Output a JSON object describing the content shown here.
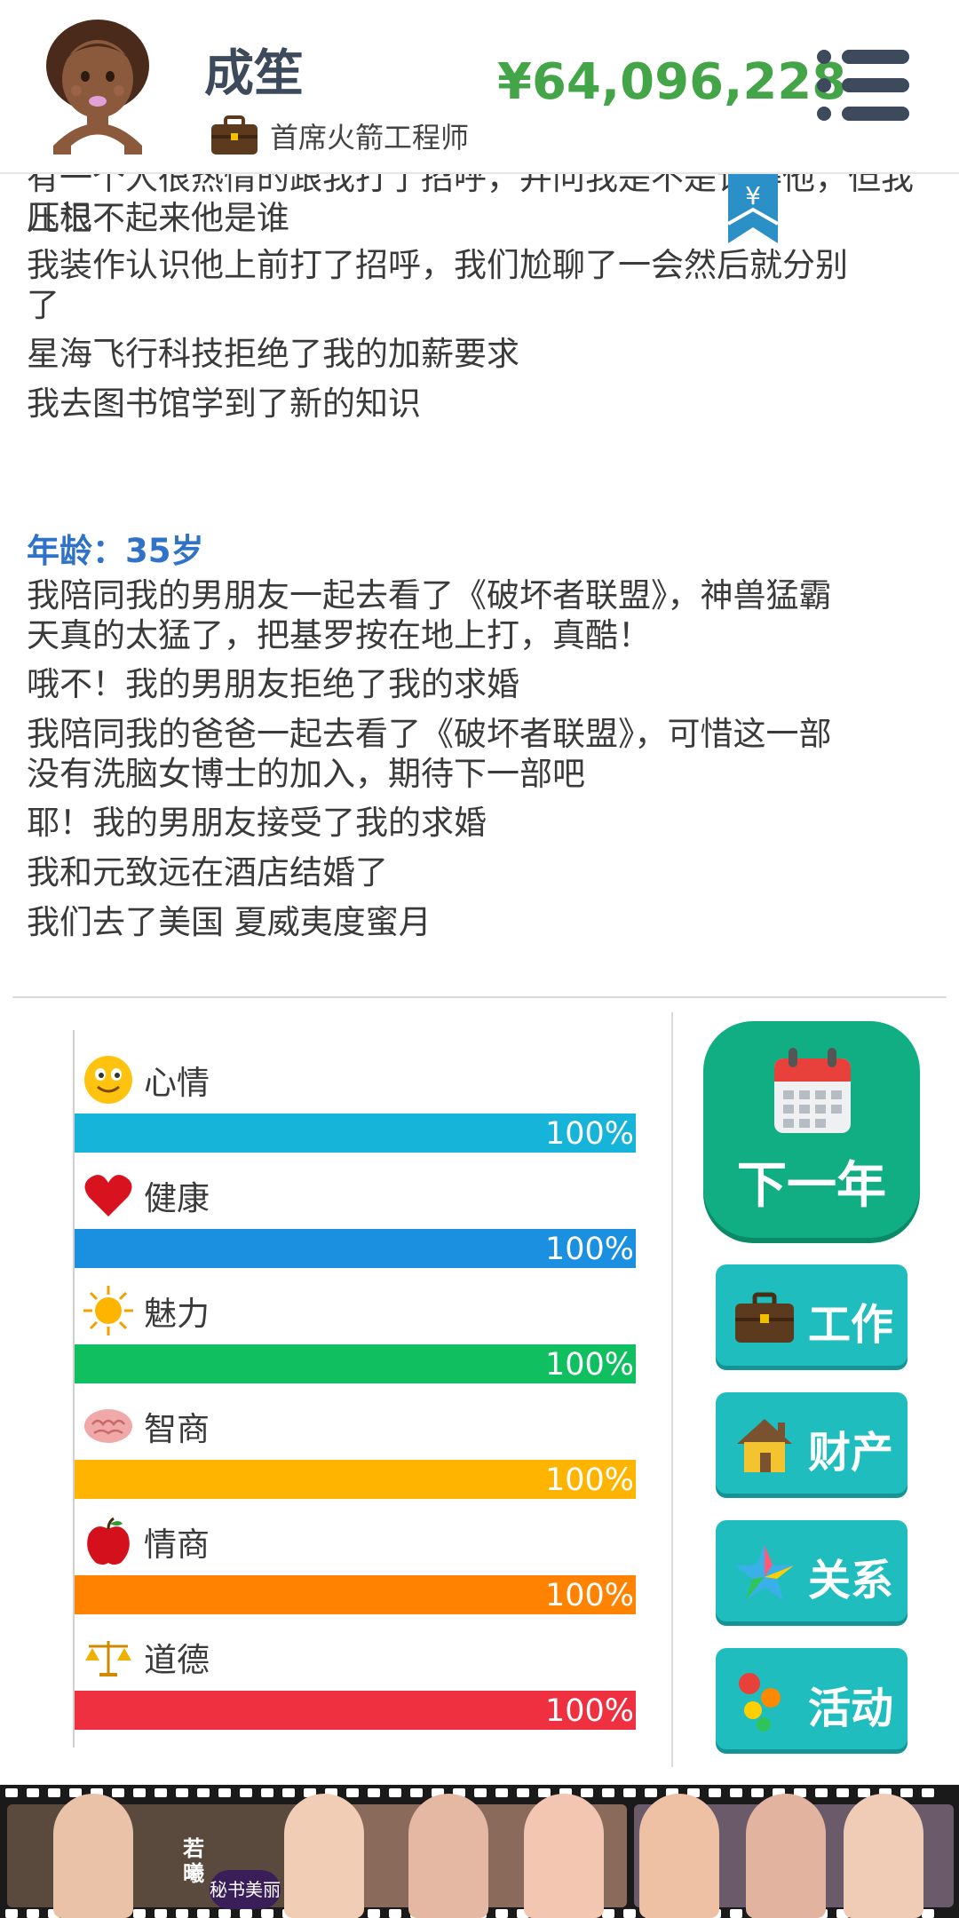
{
  "header": {
    "name": "成笙",
    "job_title": "首席火箭工程师",
    "money": "¥64,096,228"
  },
  "log": {
    "lines_top": [
      "有一个人很热情的跟我打了招呼，并问我是不是记得他，但我压根",
      "儿记不起来他是谁",
      "我装作认识他上前打了招呼，我们尬聊了一会然后就分别",
      "了",
      "星海飞行科技拒绝了我的加薪要求",
      "我去图书馆学到了新的知识"
    ],
    "age_label": "年龄：35岁",
    "lines_bottom": [
      "我陪同我的男朋友一起去看了《破坏者联盟》，神兽猛霸",
      "天真的太猛了，把基罗按在地上打，真酷！",
      "哦不！我的男朋友拒绝了我的求婚",
      "我陪同我的爸爸一起去看了《破坏者联盟》，可惜这一部",
      "没有洗脑女博士的加入，期待下一部吧",
      "耶！我的男朋友接受了我的求婚",
      "我和元致远在酒店结婚了",
      "我们去了美国 夏威夷度蜜月"
    ],
    "bookmark_symbol": "¥"
  },
  "stats": [
    {
      "label": "心情",
      "value_text": "100%",
      "value": 1.0,
      "color": "#16b4d8",
      "icon": "smiley-icon"
    },
    {
      "label": "健康",
      "value_text": "100%",
      "value": 1.0,
      "color": "#1b8fe0",
      "icon": "heart-icon"
    },
    {
      "label": "魅力",
      "value_text": "100%",
      "value": 1.0,
      "color": "#10c060",
      "icon": "sun-icon"
    },
    {
      "label": "智商",
      "value_text": "100%",
      "value": 1.0,
      "color": "#ffb400",
      "icon": "brain-icon"
    },
    {
      "label": "情商",
      "value_text": "100%",
      "value": 1.0,
      "color": "#ff8200",
      "icon": "apple-icon"
    },
    {
      "label": "道德",
      "value_text": "100%",
      "value": 1.0,
      "color": "#ef3040",
      "icon": "scales-icon"
    }
  ],
  "buttons": {
    "next_year": "下一年",
    "work": "工作",
    "property": "财产",
    "relations": "关系",
    "activities": "活动"
  },
  "colors": {
    "money": "#43a548",
    "age": "#2f72c7",
    "next_button": "#10ae82",
    "side_button": "#1fbdbd"
  },
  "banner": {
    "text": "若曦",
    "logo_text": "秘书美丽"
  }
}
